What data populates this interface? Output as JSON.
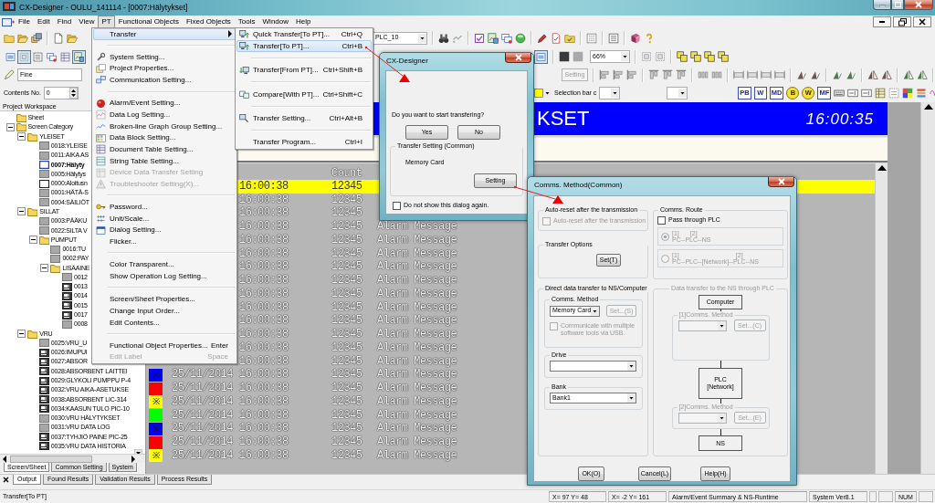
{
  "window": {
    "title": "CX-Designer - OULU_141114 - [0007:Hälytykset]"
  },
  "menu_bar": [
    {
      "label": "File",
      "selected": false
    },
    {
      "label": "Edit",
      "selected": false
    },
    {
      "label": "Find",
      "selected": false
    },
    {
      "label": "View",
      "selected": false
    },
    {
      "label": "PT",
      "selected": true
    },
    {
      "label": "Functional Objects",
      "selected": false
    },
    {
      "label": "Fixed Objects",
      "selected": false
    },
    {
      "label": "Tools",
      "selected": false
    },
    {
      "label": "Window",
      "selected": false
    },
    {
      "label": "Help",
      "selected": false
    }
  ],
  "toolbar": {
    "plc_select": "PLC_10",
    "zoom_select": "66%",
    "resolution": "Fine",
    "setting_button": {
      "label": "Setting",
      "disabled": true
    },
    "contents_label": "Contents No.",
    "contents_value": "0",
    "selection_bar_label": "Selection bar c",
    "object_buttons": [
      {
        "label": "PB",
        "kind": "square"
      },
      {
        "label": "W",
        "kind": "square"
      },
      {
        "label": "MD",
        "kind": "square"
      },
      {
        "label": "B",
        "kind": "round"
      },
      {
        "label": "W",
        "kind": "round"
      },
      {
        "label": "MF",
        "kind": "square"
      }
    ],
    "toggles": [
      {
        "pressed": false
      },
      {
        "pressed": true
      },
      {
        "pressed": false
      },
      {
        "pressed": false
      },
      {
        "pressed": false
      },
      {
        "pressed": true
      },
      {
        "pressed": true
      }
    ]
  },
  "pt_menu": [
    {
      "kind": "submenu",
      "label": "Transfer",
      "selected": true,
      "disabled": false
    },
    {
      "kind": "separator"
    },
    {
      "kind": "item",
      "label": "System Setting...",
      "selected": false,
      "disabled": false
    },
    {
      "kind": "item",
      "label": "Project Properties...",
      "selected": false,
      "disabled": false
    },
    {
      "kind": "item",
      "label": "Communication Setting...",
      "selected": false,
      "disabled": false
    },
    {
      "kind": "separator"
    },
    {
      "kind": "item",
      "label": "Alarm/Event Setting...",
      "selected": false,
      "disabled": false
    },
    {
      "kind": "item",
      "label": "Data Log Setting...",
      "selected": false,
      "disabled": false
    },
    {
      "kind": "item",
      "label": "Broken-line Graph Group Setting...",
      "selected": false,
      "disabled": false
    },
    {
      "kind": "item",
      "label": "Data Block Setting...",
      "selected": false,
      "disabled": false
    },
    {
      "kind": "item",
      "label": "Document Table Setting...",
      "selected": false,
      "disabled": false
    },
    {
      "kind": "item",
      "label": "String Table Setting...",
      "selected": false,
      "disabled": false
    },
    {
      "kind": "item",
      "label": "Device Data Transfer Setting",
      "selected": false,
      "disabled": true
    },
    {
      "kind": "item",
      "label": "Troubleshooter Setting(X)...",
      "selected": false,
      "disabled": true
    },
    {
      "kind": "separator"
    },
    {
      "kind": "item",
      "label": "Password...",
      "selected": false,
      "disabled": false
    },
    {
      "kind": "item",
      "label": "Unit/Scale...",
      "selected": false,
      "disabled": false
    },
    {
      "kind": "item",
      "label": "Dialog Setting...",
      "selected": false,
      "disabled": false
    },
    {
      "kind": "item",
      "label": "Flicker...",
      "selected": false,
      "disabled": false
    },
    {
      "kind": "separator"
    },
    {
      "kind": "item",
      "label": "Color Transparent...",
      "selected": false,
      "disabled": false
    },
    {
      "kind": "item",
      "label": "Show Operation Log Setting...",
      "selected": false,
      "disabled": false
    },
    {
      "kind": "separator"
    },
    {
      "kind": "item",
      "label": "Screen/Sheet Properties...",
      "selected": false,
      "disabled": false
    },
    {
      "kind": "item",
      "label": "Change Input Order...",
      "selected": false,
      "disabled": false
    },
    {
      "kind": "item",
      "label": "Edit Contents...",
      "selected": false,
      "disabled": false
    },
    {
      "kind": "separator"
    },
    {
      "kind": "item",
      "label": "Functional Object Properties...",
      "shortcut": "Enter",
      "selected": false,
      "disabled": false
    },
    {
      "kind": "item",
      "label": "Edit Label",
      "shortcut": "Space",
      "selected": false,
      "disabled": true
    }
  ],
  "transfer_menu": [
    {
      "kind": "item",
      "label": "Quick Transfer[To PT]...",
      "shortcut": "Ctrl+Q",
      "selected": false,
      "disabled": false
    },
    {
      "kind": "item",
      "label": "Transfer[To PT]...",
      "shortcut": "Ctrl+B",
      "selected": true,
      "disabled": false
    },
    {
      "kind": "separator"
    },
    {
      "kind": "item",
      "label": "Transfer[From PT]...",
      "shortcut": "Ctrl+Shift+B",
      "selected": false,
      "disabled": false
    },
    {
      "kind": "separator"
    },
    {
      "kind": "item",
      "label": "Compare[With PT]...",
      "shortcut": "Ctrl+Shift+C",
      "selected": false,
      "disabled": false
    },
    {
      "kind": "separator"
    },
    {
      "kind": "item",
      "label": "Transfer Setting...",
      "shortcut": "Ctrl+Alt+B",
      "selected": false,
      "disabled": false
    },
    {
      "kind": "separator"
    },
    {
      "kind": "item",
      "label": "Transfer Program...",
      "shortcut": "Ctrl+I",
      "selected": false,
      "disabled": false
    }
  ],
  "workspace": {
    "title": "Project Workspace",
    "tree": [
      {
        "label": "Sheet",
        "kind": "folder",
        "selected": false
      },
      {
        "label": "Screen Category",
        "kind": "folder",
        "selected": false,
        "expanded": true,
        "children": [
          {
            "label": "YLEISET",
            "kind": "folder",
            "selected": false,
            "expanded": true,
            "children": [
              {
                "label": "0018:YLEISE",
                "kind": "blank",
                "selected": false
              },
              {
                "label": "0011:AIKA AS",
                "kind": "blank",
                "selected": false
              },
              {
                "label": "0007:Hälyty",
                "kind": "outline",
                "selected": true
              },
              {
                "label": "0005:Hälytys",
                "kind": "blank",
                "selected": false
              },
              {
                "label": "0000:Aloitusn",
                "kind": "outline",
                "selected": false
              },
              {
                "label": "0001:HÄTÄ-S",
                "kind": "blank",
                "selected": false
              },
              {
                "label": "0004:SÄILIÖT",
                "kind": "blank",
                "selected": false
              }
            ]
          },
          {
            "label": "SILLAT",
            "kind": "folder",
            "selected": false,
            "expanded": true,
            "children": [
              {
                "label": "0003:PÄÄKU",
                "kind": "blank",
                "selected": false
              },
              {
                "label": "0022:SILTA V",
                "kind": "blank",
                "selected": false
              },
              {
                "label": "PUMPUT",
                "kind": "folder",
                "selected": false,
                "expanded": true,
                "children": [
                  {
                    "label": "0016:TU",
                    "kind": "blank",
                    "selected": false
                  },
                  {
                    "label": "0002:PAY",
                    "kind": "blank",
                    "selected": false
                  },
                  {
                    "label": "LISÄAINE",
                    "kind": "folder",
                    "selected": false,
                    "expanded": true,
                    "children": [
                      {
                        "label": "0012",
                        "kind": "blank",
                        "selected": false
                      },
                      {
                        "label": "0013",
                        "kind": "detailed",
                        "selected": false
                      },
                      {
                        "label": "0014",
                        "kind": "detailed",
                        "selected": false
                      },
                      {
                        "label": "0015",
                        "kind": "detailed",
                        "selected": false
                      },
                      {
                        "label": "0017",
                        "kind": "detailed",
                        "selected": false
                      },
                      {
                        "label": "0008",
                        "kind": "blank",
                        "selected": false
                      }
                    ]
                  }
                ]
              }
            ]
          },
          {
            "label": "VRU",
            "kind": "folder",
            "selected": false,
            "expanded": true,
            "children": [
              {
                "label": "0025:VRU_U",
                "kind": "blank",
                "selected": false
              },
              {
                "label": "0026:IMUPUI",
                "kind": "detailed",
                "selected": false
              },
              {
                "label": "0027:ABSOR",
                "kind": "detailed",
                "selected": false
              },
              {
                "label": "0028:ABSORBENT LAITTEI",
                "kind": "detailed",
                "selected": false
              },
              {
                "label": "0029:GLYKOLI PUMPPU P-4",
                "kind": "detailed",
                "selected": false
              },
              {
                "label": "0032:VRU AIKA-ASETUKSE",
                "kind": "detailed",
                "selected": false
              },
              {
                "label": "0038:ABSORBENT LIC-314",
                "kind": "detailed",
                "selected": false
              },
              {
                "label": "0034:KAASUN TULO PIC-10",
                "kind": "detailed",
                "selected": false
              },
              {
                "label": "0030:VRU HÄLYTYKSET",
                "kind": "blank",
                "selected": false
              },
              {
                "label": "0031:VRU DATA LOG",
                "kind": "blank",
                "selected": false
              },
              {
                "label": "0037:TYHJIÖ PAINE PIC-25",
                "kind": "detailed",
                "selected": false
              },
              {
                "label": "0035:VRU DATA HISTORIA",
                "kind": "detailed",
                "selected": false
              }
            ]
          }
        ]
      }
    ],
    "tabs": [
      {
        "label": "Screen/Sheet",
        "selected": true
      },
      {
        "label": "Common Setting",
        "selected": false
      },
      {
        "label": "System",
        "selected": false
      }
    ]
  },
  "screen": {
    "title": "KSET",
    "clock": "16:00:35",
    "alarm_list": {
      "count_header": "Count",
      "rows": [
        {
          "time": "16:00:38",
          "count": "12345",
          "selected": true
        },
        {
          "time": "16:00:38",
          "count": "12345",
          "selected": false
        },
        {
          "time": "16:00:38",
          "count": "12345",
          "selected": false
        },
        {
          "time": "16:00:38",
          "count": "12345",
          "message": "Alarm Message",
          "selected": false
        },
        {
          "time": "16:00:38",
          "count": "12345",
          "message": "Alarm Message",
          "selected": false
        },
        {
          "time": "16:00:38",
          "count": "12345",
          "message": "Alarm Message",
          "selected": false
        },
        {
          "time": "16:00:38",
          "count": "12345",
          "message": "Alarm Message",
          "selected": false
        },
        {
          "time": "16:00:38",
          "count": "12345",
          "message": "Alarm Message",
          "selected": false
        },
        {
          "time": "16:00:38",
          "count": "12345",
          "message": "Alarm Message",
          "selected": false
        },
        {
          "time": "16:00:38",
          "count": "12345",
          "message": "Alarm Message",
          "selected": false
        },
        {
          "time": "16:00:38",
          "count": "12345",
          "message": "Alarm Message",
          "selected": false
        },
        {
          "time": "16:00:38",
          "count": "12345",
          "message": "Alarm Message",
          "selected": false
        },
        {
          "time": "16:00:38",
          "count": "12345",
          "message": "Alarm Message",
          "selected": false
        },
        {
          "time": "16:00:38",
          "count": "12345",
          "message": "Alarm Message",
          "selected": false
        },
        {
          "color": "#0000ff",
          "symbol": "※",
          "date": "25/11/2014",
          "time": "16:00:38",
          "count": "12345",
          "message": "Alarm Message",
          "selected": false
        },
        {
          "color": "#ff0000",
          "date": "25/11/2014",
          "time": "16:00:38",
          "count": "12345",
          "message": "Alarm Message",
          "selected": false
        },
        {
          "color": "#ffff00",
          "symbol": "※",
          "date": "25/11/2014",
          "time": "16:00:38",
          "count": "12345",
          "message": "Alarm Message",
          "selected": false
        },
        {
          "color": "#00ff00",
          "date": "25/11/2014",
          "time": "16:00:38",
          "count": "12345",
          "message": "Alarm Message",
          "selected": false
        },
        {
          "color": "#0000ff",
          "symbol": "※",
          "date": "25/11/2014",
          "time": "16:00:38",
          "count": "12345",
          "message": "Alarm Message",
          "selected": false
        },
        {
          "color": "#ff0000",
          "date": "25/11/2014",
          "time": "16:00:38",
          "count": "12345",
          "message": "Alarm Message",
          "selected": false
        },
        {
          "color": "#ffff00",
          "symbol": "※",
          "date": "25/11/2014",
          "time": "16:00:38",
          "count": "12345",
          "message": "Alarm Message",
          "selected": false
        }
      ]
    }
  },
  "confirm_dialog": {
    "title": "CX-Designer",
    "question": "Do you want to start transfering?",
    "buttons": [
      "Yes",
      "No"
    ],
    "group_title": "Transfer Setting (Common)",
    "target": "Memory Card",
    "setting_button": "Setting",
    "dont_show": {
      "label": "Do not show this dialog again.",
      "checked": false
    }
  },
  "comms_dialog": {
    "title": "Comms. Method(Common)",
    "auto_reset": {
      "title": "Auto-reset after the transmission",
      "label": "Auto-reset after the transmission",
      "checked": false,
      "disabled": true
    },
    "transfer_options": {
      "title": "Transfer Options",
      "button": "Set(T)"
    },
    "route": {
      "title": "Comms. Route",
      "pass_through": {
        "label": "Pass through PLC",
        "checked": false
      },
      "options": [
        {
          "ports": [
            "[1]",
            "[2]"
          ],
          "path": "PC--PLC--NS",
          "selected": true,
          "disabled": true
        },
        {
          "ports": [
            "[1]",
            "[2]"
          ],
          "path": "PC--PLC--[Network]--PLC--NS",
          "selected": false,
          "disabled": true
        }
      ]
    },
    "direct": {
      "title": "Direct data transfer to NS/Computer",
      "method_title": "Comms. Method",
      "method": "Memory Card",
      "method_button": {
        "label": "Set...(S)",
        "disabled": true
      },
      "usb": {
        "label": "Communicate with multiple software tools via USB.",
        "checked": false,
        "disabled": true
      },
      "drive_title": "Drive",
      "bank_title": "Bank",
      "bank": "Bank1"
    },
    "via_plc": {
      "title": "Data transfer to the NS through PLC",
      "disabled": true,
      "nodes": [
        "Computer",
        "PLC\n[Network]",
        "NS"
      ],
      "methods": [
        {
          "title": "[1]Comms. Method",
          "button": "Set...(C)"
        },
        {
          "title": "[2]Comms. Method",
          "button": "Set...(E)"
        }
      ]
    },
    "buttons": [
      "OK(O)",
      "Cancel(L)",
      "Help(H)"
    ]
  },
  "output_tabs": [
    {
      "label": "Output",
      "selected": true
    },
    {
      "label": "Found Results",
      "selected": false
    },
    {
      "label": "Validation Results",
      "selected": false
    },
    {
      "label": "Process Results",
      "selected": false
    }
  ],
  "status_bar": {
    "message": "Transfer[To PT]",
    "panes": [
      "X= 97 Y= 48",
      "X= -2 Y= 161",
      "Alarm/Event Summary & NS-Runtime",
      "System Ver8.1",
      "NUM"
    ]
  }
}
